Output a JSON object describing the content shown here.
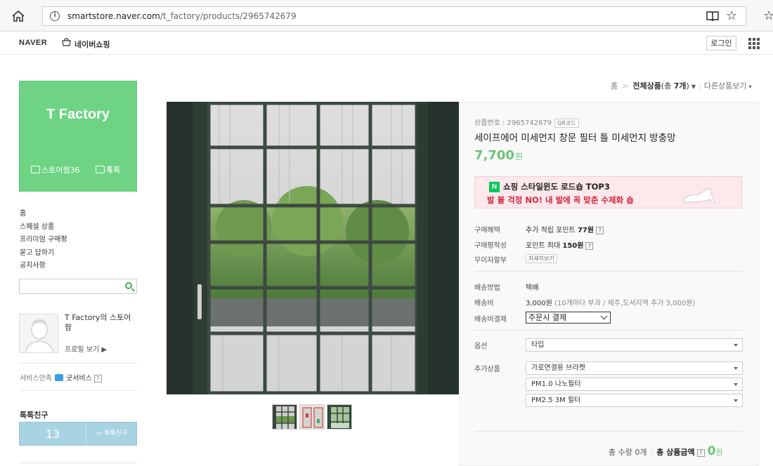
{
  "browser": {
    "url_domain": "smartstore.naver.com",
    "url_path": "/t_factory/products/2965742679"
  },
  "naver_bar": {
    "logo": "NAVER",
    "shopping": "네이버쇼핑",
    "login": "로그인"
  },
  "store": {
    "name": "T Factory",
    "zzim_label": "스토어찜",
    "zzim_count": "36",
    "talk_label": "톡톡"
  },
  "sidebar_menu": [
    "홈",
    "스페셜 상품",
    "프리미엄 구매평",
    "묻고 답하기",
    "공지사항"
  ],
  "profile": {
    "name": "T Factory의 스토어팜",
    "link": "프로필 보기 ▶"
  },
  "service": {
    "label": "서비스만족",
    "grade": "굿서비스",
    "help": "?"
  },
  "talk_friend": {
    "title": "톡톡친구",
    "count": "13",
    "button": "톡톡친구"
  },
  "breadcrumb": {
    "home": "홈",
    "current": "전체상품",
    "count_prefix": "(총 ",
    "count": "7개",
    "count_suffix": ")",
    "other": "다른상품보기"
  },
  "product": {
    "number_label": "상품번호 : 2965742679",
    "qr": "QR코드",
    "title": "세이프에어 미세먼지 창문 필터 틀 미세먼지 방충망",
    "price": "7,700",
    "price_unit": "원"
  },
  "banner": {
    "logo": "N",
    "line1": "쇼핑 스타일윈도 로드숍 TOP3",
    "line2": "발 볼 걱정 NO! 내 발에 꼭 맞춘 수제화 숍"
  },
  "benefits": [
    {
      "key": "구매혜택",
      "prefix": "추가 적립 포인트 ",
      "strong": "77원",
      "help": "?"
    },
    {
      "key": "구매평작성",
      "prefix": "포인트 최대 ",
      "strong": "150원",
      "help": "?"
    }
  ],
  "installment": {
    "key": "무이자할부",
    "button": "자세히보기"
  },
  "shipping": {
    "method_key": "배송방법",
    "method": "택배",
    "fee_key": "배송비",
    "fee": "3,000원",
    "fee_note": "(10개마다 부과 / 제주,도서지역 추가 3,000원)",
    "pay_key": "배송비결제",
    "pay_value": "주문시 결제"
  },
  "options": {
    "key": "옵션",
    "value": "타입"
  },
  "addons": {
    "key": "추가상품",
    "items": [
      "가로연결용 브라켓",
      "PM1.0 나노필터",
      "PM2.5 3M 필터"
    ]
  },
  "total": {
    "qty_label": "총 수량",
    "qty": "0개",
    "amount_label": "총 상품금액",
    "help": "?",
    "amount": "0",
    "unit": "원"
  },
  "colors": {
    "store_green": "#6ed484",
    "price_green": "#6cc577",
    "banner_red": "#d0263c",
    "friend_blue": "#a8d3e3"
  }
}
